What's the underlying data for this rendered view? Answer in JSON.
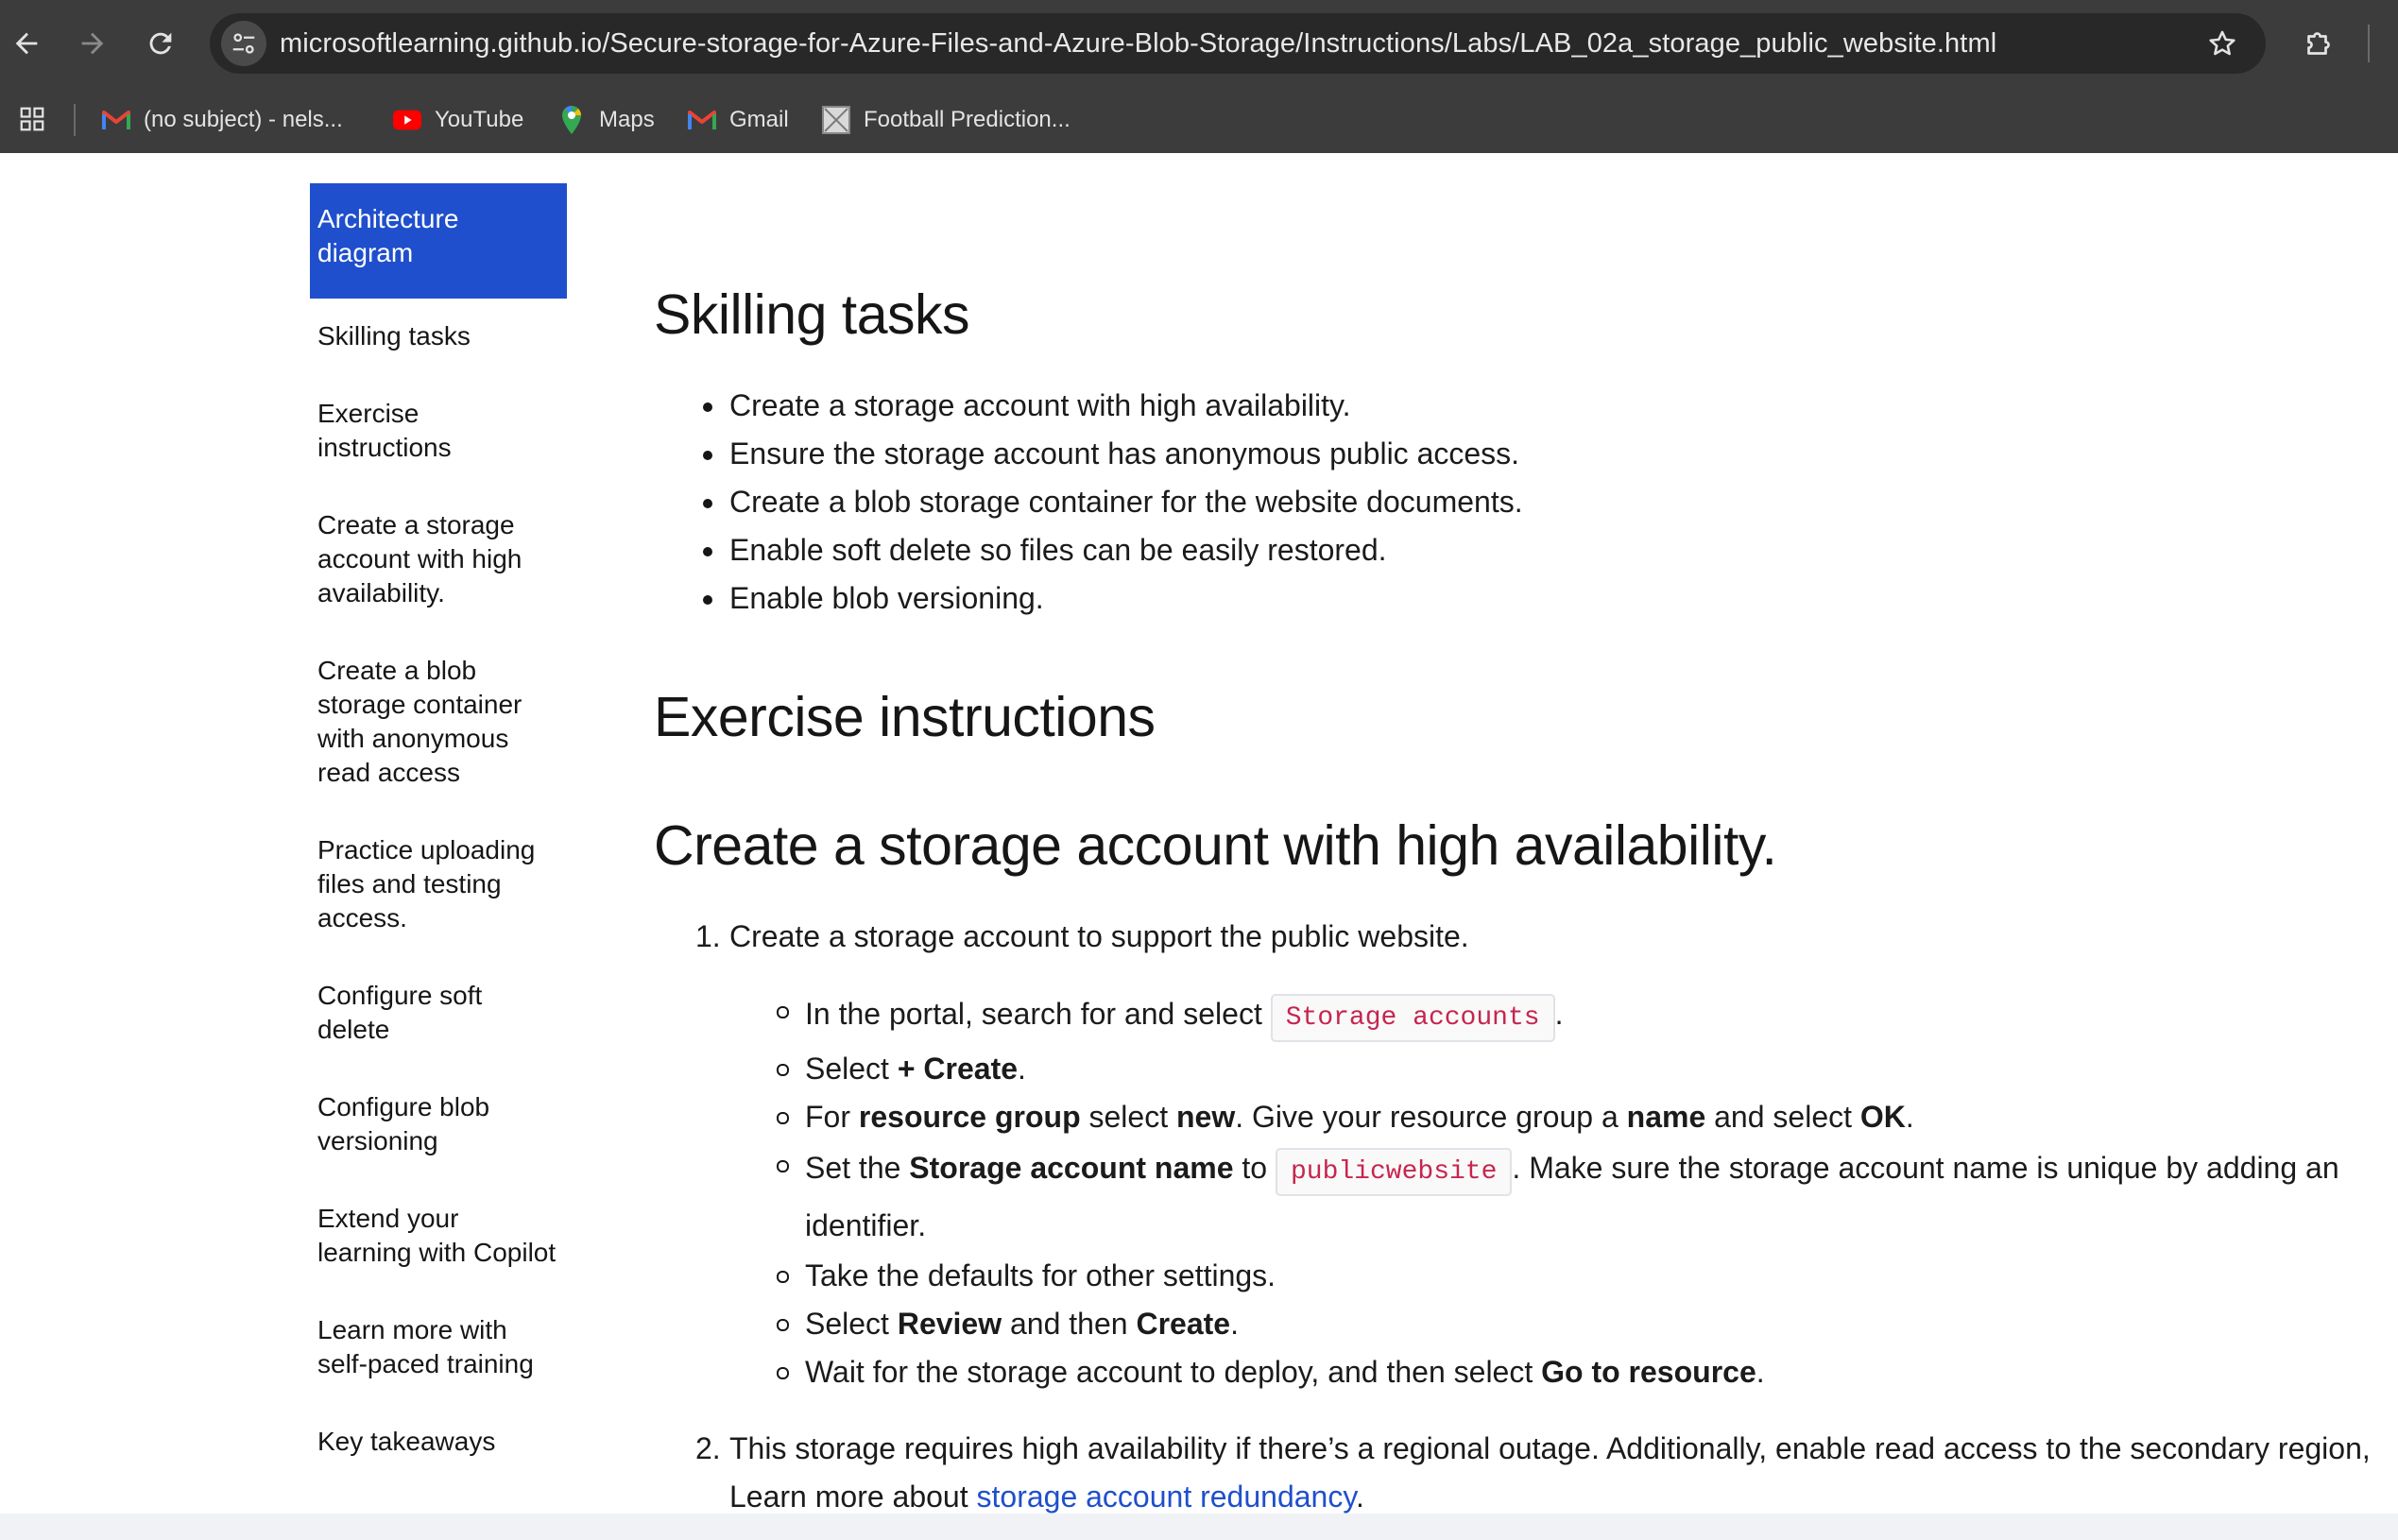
{
  "browser": {
    "url": "microsoftlearning.github.io/Secure-storage-for-Azure-Files-and-Azure-Blob-Storage/Instructions/Labs/LAB_02a_storage_public_website.html",
    "bookmarks": [
      {
        "label": "(no subject) - nels...",
        "icon": "gmail-icon"
      },
      {
        "label": "YouTube",
        "icon": "youtube-icon"
      },
      {
        "label": "Maps",
        "icon": "maps-icon"
      },
      {
        "label": "Gmail",
        "icon": "gmail-icon"
      },
      {
        "label": "Football Prediction...",
        "icon": "football-prediction-icon"
      }
    ]
  },
  "sidebar": {
    "items": [
      {
        "label": "Architecture diagram",
        "active": true
      },
      {
        "label": "Skilling tasks"
      },
      {
        "label": "Exercise instructions"
      },
      {
        "label": "Create a storage account with high availability."
      },
      {
        "label": "Create a blob storage container with anonymous read access"
      },
      {
        "label": "Practice uploading files and testing access."
      },
      {
        "label": "Configure soft delete"
      },
      {
        "label": "Configure blob versioning"
      },
      {
        "label": "Extend your learning with Copilot"
      },
      {
        "label": "Learn more with self-paced training"
      },
      {
        "label": "Key takeaways"
      }
    ]
  },
  "main": {
    "skilling_heading": "Skilling tasks",
    "skilling_items": [
      "Create a storage account with high availability.",
      "Ensure the storage account has anonymous public access.",
      "Create a blob storage container for the website documents.",
      "Enable soft delete so files can be easily restored.",
      "Enable blob versioning."
    ],
    "exercise_heading": "Exercise instructions",
    "create_heading": "Create a storage account with high availability.",
    "step1": {
      "num": "1.",
      "text": "Create a storage account to support the public website.",
      "sub": {
        "s1_pre": "In the portal, search for and select ",
        "s1_code": "Storage accounts",
        "s1_post": ".",
        "s2_pre": "Select ",
        "s2_bold": "+ Create",
        "s2_post": ".",
        "s3_a": "For ",
        "s3_b": "resource group",
        "s3_c": " select ",
        "s3_d": "new",
        "s3_e": ". Give your resource group a ",
        "s3_f": "name",
        "s3_g": " and select ",
        "s3_h": "OK",
        "s3_i": ".",
        "s4_a": "Set the ",
        "s4_b": "Storage account name",
        "s4_c": " to ",
        "s4_code": "publicwebsite",
        "s4_d": ". Make sure the storage account name is unique by adding an identifier.",
        "s5": "Take the defaults for other settings.",
        "s6_a": "Select ",
        "s6_b": "Review",
        "s6_c": " and then ",
        "s6_d": "Create",
        "s6_e": ".",
        "s7_a": "Wait for the storage account to deploy, and then select ",
        "s7_b": "Go to resource",
        "s7_c": "."
      }
    },
    "step2": {
      "num": "2.",
      "text": "This storage requires high availability if there’s a regional outage. Additionally, enable read access to the secondary region, Learn more about ",
      "link": "storage account redundancy",
      "post": "."
    }
  }
}
